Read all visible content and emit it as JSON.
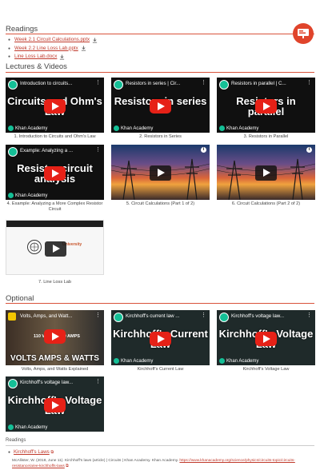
{
  "readings": {
    "heading": "Readings",
    "items": [
      {
        "label": "Week 2.1 Circuit Calculations.pptx"
      },
      {
        "label": "Week 2.2 Line Loss Lab.pptx"
      },
      {
        "label": "Line Loss Lab.docx"
      }
    ]
  },
  "lectures": {
    "heading": "Lectures & Videos",
    "videos": [
      {
        "title": "Introduction to circuits...",
        "big": "Circuits and Ohm's Law",
        "caption": "1. Introduction to Circuits and Ohm's Law",
        "channel": "Khan Academy"
      },
      {
        "title": "Resistors in series | Cir...",
        "big": "Resistors in series",
        "caption": "2. Resistors in Series",
        "channel": "Khan Academy"
      },
      {
        "title": "Resistors in parallel | C...",
        "big": "Resistors in parallel",
        "caption": "3. Resistors in Parallel",
        "channel": "Khan Academy"
      },
      {
        "title": "Example: Analyzing a ...",
        "big": "Resistor circuit analysis",
        "caption": "4. Example: Analyzing a More Complex Resistor Circuit",
        "channel": "Khan Academy"
      },
      {
        "caption": "5. Circuit Calculations (Part 1 of 2)"
      },
      {
        "caption": "6. Circuit Calculations (Part 2 of 2)"
      },
      {
        "label": "University",
        "caption": "7. Line Loss Lab"
      }
    ]
  },
  "optional": {
    "heading": "Optional",
    "videos": [
      {
        "title": "Volts, Amps, and Watt...",
        "big": "VOLTS AMPS & WATTS",
        "sub": "110 VOLTS × 10 AMPS",
        "caption": "Volts, Amps, and Watts Explained"
      },
      {
        "title": "Kirchhoff's current law ...",
        "big": "Kirchhoff's Current Law",
        "caption": "Kirchhoff's Current Law",
        "channel": "Khan Academy"
      },
      {
        "title": "Kirchhoff's voltage law...",
        "big": "Kirchhoff's Voltage Law",
        "caption": "Kirchhoff's Voltage Law",
        "channel": "Khan Academy"
      },
      {
        "title": "Kirchhoff's voltage law...",
        "big": "Kirchhoff's Voltage Law",
        "caption": "",
        "channel": "Khan Academy"
      }
    ]
  },
  "references": {
    "heading": "Readings",
    "item": "Kirchhoff's Laws",
    "citation_prefix": "McAllister, W. (2018, June 11). Kirchhoff's laws (article) | Circuits | Khan Academy. Khan Academy.",
    "citation_link": "https://www.khanacademy.org/science/physics/circuits-topic/circuits-resistance/a/ee-kirchhoffs-laws"
  },
  "colors": {
    "accent": "#d9533b",
    "link": "#c0392b",
    "ka_green": "#14bf96",
    "yt_red": "#e62117"
  }
}
